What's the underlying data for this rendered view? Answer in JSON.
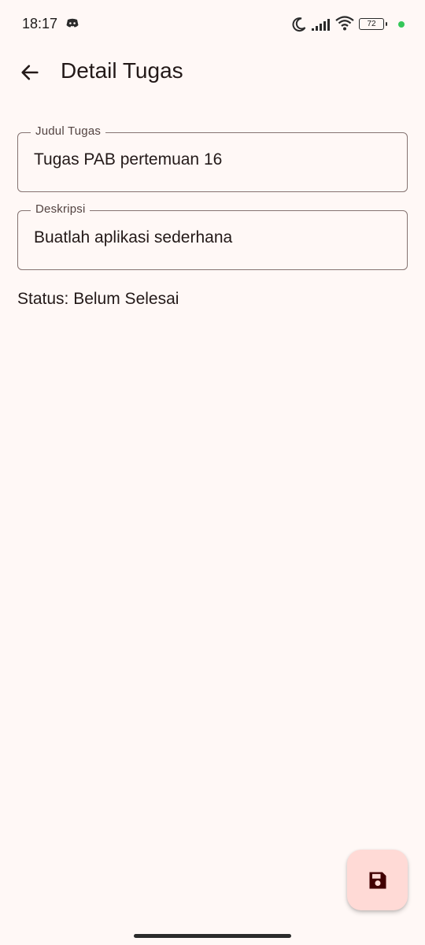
{
  "status_bar": {
    "time": "18:17",
    "battery_level": "72",
    "icons": [
      "discord-icon",
      "moon-icon",
      "signal-icon",
      "wifi-icon",
      "battery-icon",
      "privacy-dot-icon"
    ]
  },
  "app_bar": {
    "back_icon": "arrow-back-icon",
    "title": "Detail Tugas"
  },
  "form": {
    "title_field": {
      "label": "Judul Tugas",
      "value": "Tugas PAB pertemuan 16"
    },
    "description_field": {
      "label": "Deskripsi",
      "value": "Buatlah aplikasi sederhana"
    },
    "status_text": "Status: Belum Selesai"
  },
  "fab": {
    "icon": "save-icon"
  },
  "colors": {
    "background": "#fff8f6",
    "fab_background": "#ffdad6",
    "fab_icon": "#410002",
    "outline": "#857371",
    "privacy_dot": "#35c759"
  }
}
